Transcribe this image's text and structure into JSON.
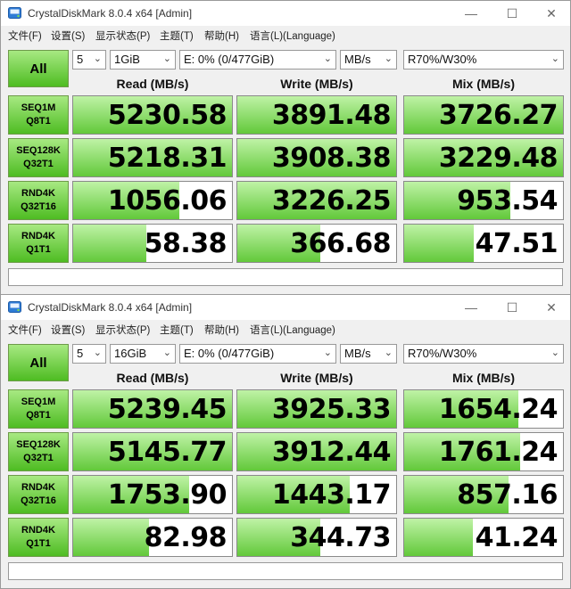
{
  "windows": [
    {
      "title": "CrystalDiskMark 8.0.4 x64 [Admin]",
      "menu": [
        "文件(F)",
        "设置(S)",
        "显示状态(P)",
        "主题(T)",
        "帮助(H)",
        "语言(L)(Language)"
      ],
      "all_label": "All",
      "count": "5",
      "size": "1GiB",
      "drive": "E: 0% (0/477GiB)",
      "unit": "MB/s",
      "profile": "R70%/W30%",
      "headers": {
        "read": "Read (MB/s)",
        "write": "Write (MB/s)",
        "mix": "Mix (MB/s)"
      },
      "rows": [
        {
          "label1": "SEQ1M",
          "label2": "Q8T1",
          "read": "5230.58",
          "write": "3891.48",
          "mix": "3726.27",
          "read_fill": 1.0,
          "write_fill": 1.0,
          "mix_fill": 1.0
        },
        {
          "label1": "SEQ128K",
          "label2": "Q32T1",
          "read": "5218.31",
          "write": "3908.38",
          "mix": "3229.48",
          "read_fill": 1.0,
          "write_fill": 1.0,
          "mix_fill": 1.0
        },
        {
          "label1": "RND4K",
          "label2": "Q32T16",
          "read": "1056.06",
          "write": "3226.25",
          "mix": "953.54",
          "read_fill": 0.67,
          "write_fill": 1.0,
          "mix_fill": 0.67
        },
        {
          "label1": "RND4K",
          "label2": "Q1T1",
          "read": "58.38",
          "write": "366.68",
          "mix": "47.51",
          "read_fill": 0.46,
          "write_fill": 0.52,
          "mix_fill": 0.44
        }
      ]
    },
    {
      "title": "CrystalDiskMark 8.0.4 x64 [Admin]",
      "menu": [
        "文件(F)",
        "设置(S)",
        "显示状态(P)",
        "主题(T)",
        "帮助(H)",
        "语言(L)(Language)"
      ],
      "all_label": "All",
      "count": "5",
      "size": "16GiB",
      "drive": "E: 0% (0/477GiB)",
      "unit": "MB/s",
      "profile": "R70%/W30%",
      "headers": {
        "read": "Read (MB/s)",
        "write": "Write (MB/s)",
        "mix": "Mix (MB/s)"
      },
      "rows": [
        {
          "label1": "SEQ1M",
          "label2": "Q8T1",
          "read": "5239.45",
          "write": "3925.33",
          "mix": "1654.24",
          "read_fill": 1.0,
          "write_fill": 1.0,
          "mix_fill": 0.72
        },
        {
          "label1": "SEQ128K",
          "label2": "Q32T1",
          "read": "5145.77",
          "write": "3912.44",
          "mix": "1761.24",
          "read_fill": 1.0,
          "write_fill": 1.0,
          "mix_fill": 0.73
        },
        {
          "label1": "RND4K",
          "label2": "Q32T16",
          "read": "1753.90",
          "write": "1443.17",
          "mix": "857.16",
          "read_fill": 0.73,
          "write_fill": 0.71,
          "mix_fill": 0.66
        },
        {
          "label1": "RND4K",
          "label2": "Q1T1",
          "read": "82.98",
          "write": "344.73",
          "mix": "41.24",
          "read_fill": 0.48,
          "write_fill": 0.52,
          "mix_fill": 0.43
        }
      ]
    }
  ],
  "colors": {
    "accent_green": "#4ebc22",
    "fill_green": "#62c93a",
    "light_green": "#bff3a6"
  },
  "icons": {
    "app": "crystaldiskmark-disk-icon",
    "minimize": "minimize-icon",
    "maximize": "maximize-icon",
    "close": "close-icon",
    "dropdown": "chevron-down-icon"
  }
}
